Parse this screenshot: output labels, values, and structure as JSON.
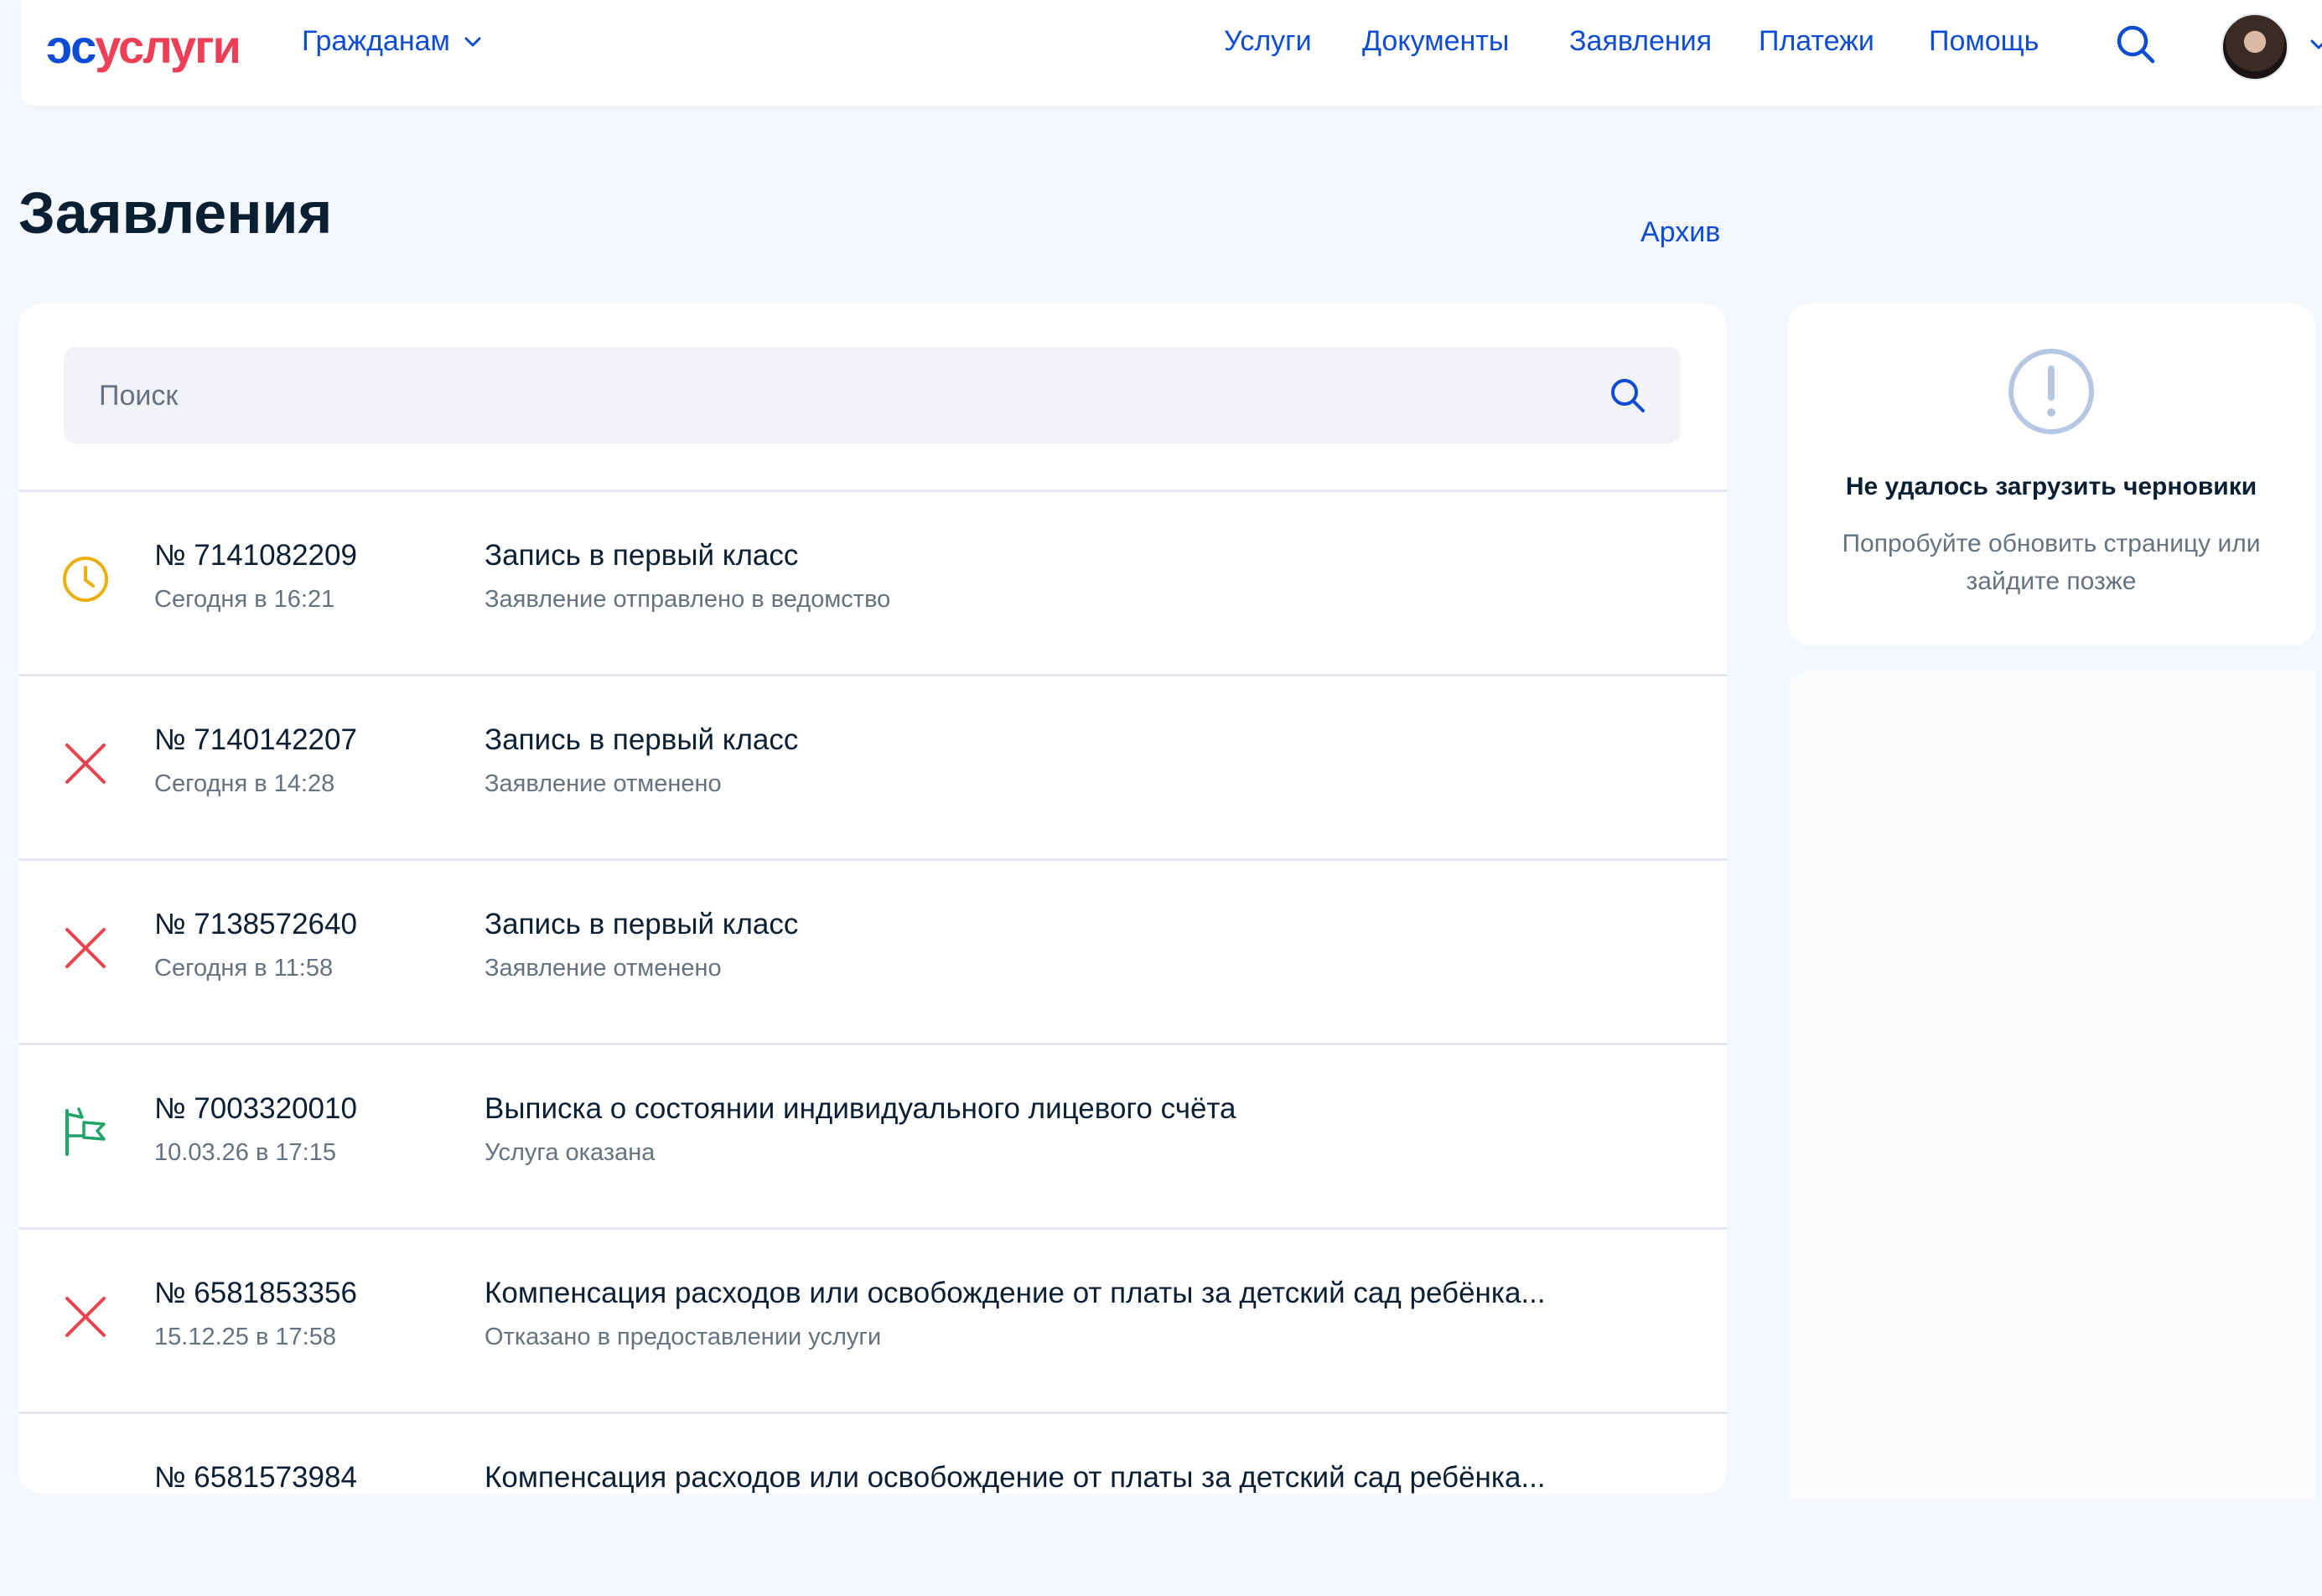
{
  "header": {
    "logo_part1": "ɔс",
    "logo_part2": "услуги",
    "citizens_label": "Гражданам",
    "nav": [
      {
        "label": "Услуги"
      },
      {
        "label": "Документы"
      },
      {
        "label": "Заявления"
      },
      {
        "label": "Платежи"
      },
      {
        "label": "Помощь"
      }
    ]
  },
  "page": {
    "title": "Заявления",
    "archive_label": "Архив"
  },
  "search": {
    "placeholder": "Поиск"
  },
  "applications": [
    {
      "number": "№ 7141082209",
      "date": "Сегодня в 16:21",
      "title": "Запись в первый класс",
      "status": "Заявление отправлено в ведомство",
      "icon": "clock-icon"
    },
    {
      "number": "№ 7140142207",
      "date": "Сегодня в 14:28",
      "title": "Запись в первый класс",
      "status": "Заявление отменено",
      "icon": "cross-icon"
    },
    {
      "number": "№ 7138572640",
      "date": "Сегодня в 11:58",
      "title": "Запись в первый класс",
      "status": "Заявление отменено",
      "icon": "cross-icon"
    },
    {
      "number": "№ 7003320010",
      "date": "10.03.26 в 17:15",
      "title": "Выписка о состоянии индивидуального лицевого счёта",
      "status": "Услуга оказана",
      "icon": "flag-icon"
    },
    {
      "number": "№ 6581853356",
      "date": "15.12.25 в 17:58",
      "title": "Компенсация расходов или освобождение от платы за детский сад ребёнка...",
      "status": "Отказано в предоставлении услуги",
      "icon": "cross-icon"
    },
    {
      "number": "№ 6581573984",
      "date": "",
      "title": "Компенсация расходов или освобождение от платы за детский сад ребёнка...",
      "status": "",
      "icon": ""
    }
  ],
  "drafts": {
    "title": "Не удалось загрузить черновики",
    "text": "Попробуйте обновить страницу или зайдите позже"
  },
  "colors": {
    "brand_blue": "#0d4cd3",
    "brand_red": "#ee3f58",
    "clock": "#e9b010",
    "cross": "#e8414f",
    "flag": "#1fa36a"
  }
}
